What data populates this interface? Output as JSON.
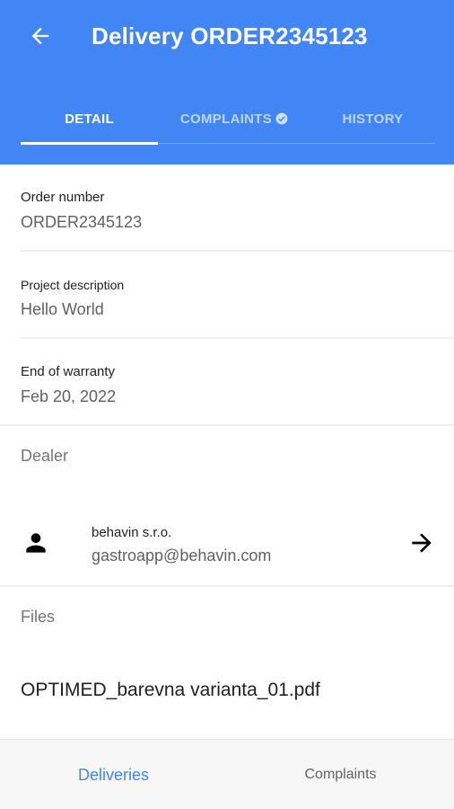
{
  "app_bar": {
    "title": "Delivery ORDER2345123",
    "background_color": "#4285f4",
    "back_icon": "arrow-back-icon"
  },
  "tabs": [
    {
      "label": "DETAIL",
      "active": true
    },
    {
      "label": "COMPLAINTS",
      "active": false,
      "icon": "check-circle-icon"
    },
    {
      "label": "HISTORY",
      "active": false
    }
  ],
  "details": {
    "order_number": {
      "label": "Order number",
      "value": "ORDER2345123"
    },
    "project_description": {
      "label": "Project description",
      "value": "Hello World"
    },
    "end_of_warranty": {
      "label": "End of warranty",
      "value": "Feb 20, 2022"
    }
  },
  "dealer": {
    "section_title": "Dealer",
    "icon": "person-icon",
    "name": "behavin s.r.o.",
    "email": "gastroapp@behavin.com",
    "action_icon": "arrow-forward-icon"
  },
  "files": {
    "section_title": "Files",
    "items": [
      "OPTIMED_barevna varianta_01.pdf"
    ]
  },
  "bottom_nav": {
    "items": [
      {
        "label": "Deliveries",
        "active": true
      },
      {
        "label": "Complaints",
        "active": false
      }
    ],
    "active_color": "#4285f4"
  }
}
